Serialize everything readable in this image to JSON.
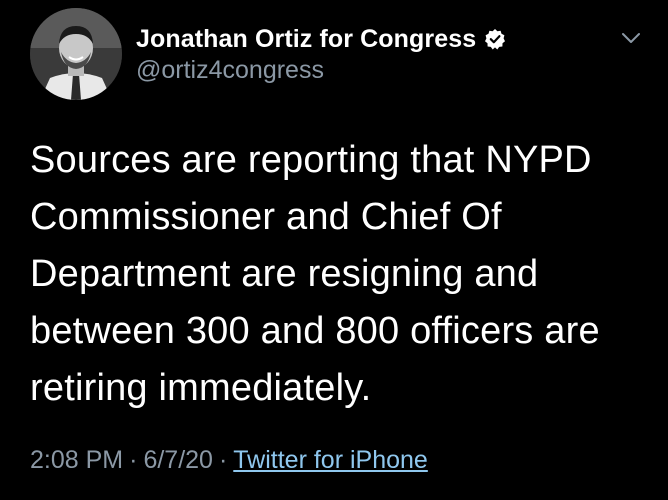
{
  "tweet": {
    "author": {
      "display_name": "Jonathan Ortiz for Congress",
      "handle": "@ortiz4congress",
      "verified": true
    },
    "text_lines": [
      "Sources are reporting that NYPD",
      "Commissioner and Chief Of",
      "Department are resigning and",
      "between 300 and 800 officers are",
      "retiring immediately."
    ],
    "time": "2:08 PM",
    "separator": "·",
    "date": "6/7/20",
    "source": "Twitter for iPhone"
  },
  "icons": {
    "verified": "verified-badge-icon",
    "menu": "chevron-down-icon"
  },
  "colors": {
    "background": "#000000",
    "text": "#ffffff",
    "muted": "#8b98a5",
    "link": "#8fc7ee"
  }
}
